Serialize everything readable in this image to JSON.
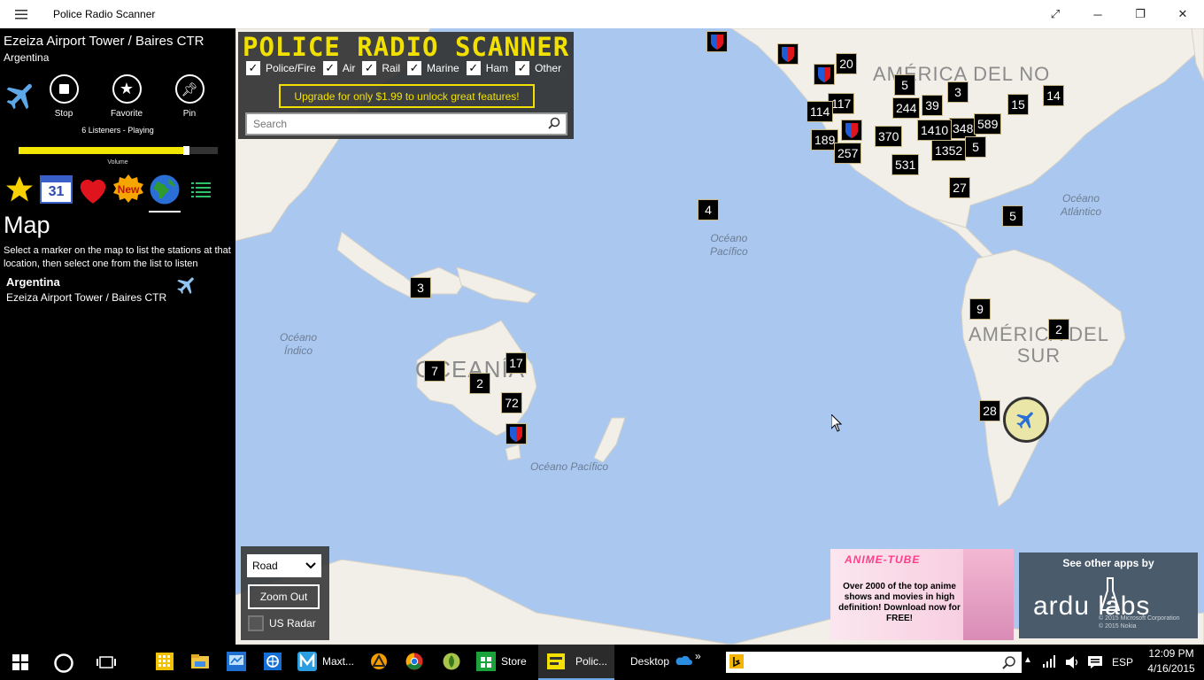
{
  "titlebar": {
    "title": "Police Radio Scanner"
  },
  "sidebar": {
    "station_name": "Ezeiza Airport Tower / Baires CTR",
    "station_country": "Argentina",
    "controls": {
      "stop": "Stop",
      "favorite": "Favorite",
      "pin": "Pin"
    },
    "listeners": "6 Listeners  -  Playing",
    "volume_label": "Volume",
    "volume_level": 0.84,
    "calendar_day": "31",
    "new_badge": "New",
    "heading": "Map",
    "description": "Select a marker on the map to list the stations at that location, then select one from the list to listen",
    "list": [
      {
        "country": "Argentina",
        "station": "Ezeiza Airport Tower / Baires CTR"
      }
    ]
  },
  "header": {
    "brand": "POLICE RADIO SCANNER",
    "filters": [
      "Police/Fire",
      "Air",
      "Rail",
      "Marine",
      "Ham",
      "Other"
    ],
    "upgrade": "Upgrade for only $1.99 to unlock great features!",
    "search_placeholder": "Search"
  },
  "map": {
    "oceans": {
      "pacific_n": "Océano\nPacífico",
      "pacific_s": "Océano Pacífico",
      "atlantic": "Océano\nAtlántico",
      "indian": "Océano\nÍndico"
    },
    "continents": {
      "north_america": "AMÉRICA DEL NO",
      "south_america": "AMÉRICA DEL\nSUR",
      "oceania": "OCEANÍA"
    },
    "markers": [
      "20",
      "5",
      "3",
      "117",
      "114",
      "244",
      "39",
      "348",
      "589",
      "15",
      "14",
      "1410",
      "189",
      "257",
      "370",
      "1352",
      "5",
      "531",
      "27",
      "5",
      "4",
      "3",
      "9",
      "2",
      "28",
      "7",
      "17",
      "2",
      "72"
    ],
    "controls": {
      "map_type": "Road",
      "zoom_out": "Zoom Out",
      "us_radar": "US Radar"
    }
  },
  "ads": {
    "anime": {
      "brand": "ANIME-TUBE",
      "text": "Over 2000 of the top anime shows and movies in high definition! Download now for FREE!"
    },
    "arduo": {
      "title": "See other apps by",
      "logo": "ardu labs",
      "copyright1": "© 2015 Microsoft Corporation",
      "copyright2": "© 2015 Nokia"
    }
  },
  "taskbar": {
    "items": [
      "Maxt...",
      "Store",
      "Polic...",
      "Desktop"
    ],
    "language": "ESP",
    "time": "12:09 PM",
    "date": "4/16/2015"
  }
}
